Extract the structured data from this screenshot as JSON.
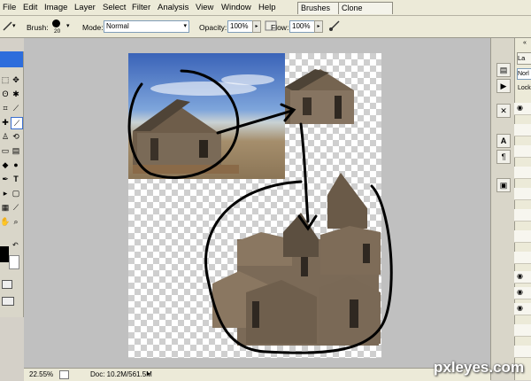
{
  "menu": {
    "items": [
      "File",
      "Edit",
      "Image",
      "Layer",
      "Select",
      "Filter",
      "Analysis",
      "View",
      "Window",
      "Help"
    ]
  },
  "panel_tabs": {
    "brushes": "Brushes",
    "brushes_close": "×",
    "clone_source": "Clone Source"
  },
  "options": {
    "brush_label": "Brush:",
    "brush_size": "20",
    "mode_label": "Mode:",
    "mode_value": "Normal",
    "opacity_label": "Opacity:",
    "opacity_value": "100%",
    "flow_label": "Flow:",
    "flow_value": "100%"
  },
  "layers_panel": {
    "tab_label": "La",
    "blend_mode": "Norl",
    "lock_label": "Lock"
  },
  "status": {
    "zoom": "22.55%",
    "doc": "Doc: 10.2M/561.5M"
  },
  "watermark": "pxleyes.com",
  "colors": {
    "menubar": "#ecead8",
    "workspace": "#c0c0c0",
    "toolbox_header": "#2d6ddc",
    "foreground_swatch": "#000000",
    "background_swatch": "#ffffff"
  }
}
